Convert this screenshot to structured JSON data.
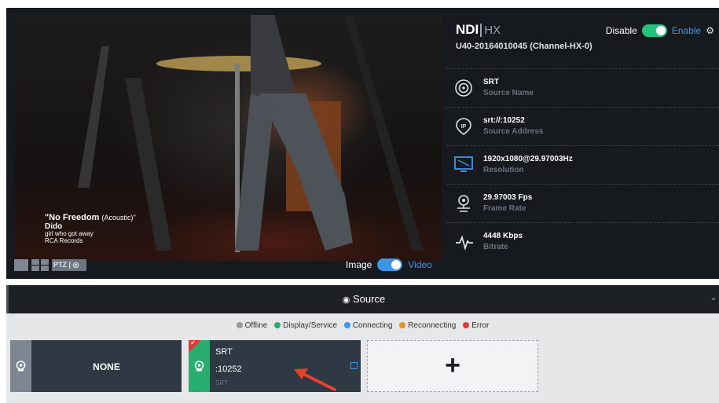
{
  "video": {
    "caption": {
      "song": "\"No Freedom",
      "song_suffix": "(Acoustic)\"",
      "artist": "Dido",
      "album": "girl who got away",
      "label": "RCA Records"
    }
  },
  "header": {
    "logo_main": "NDI",
    "logo_suffix": "HX",
    "device_name": "U40-20164010045 (Channel-HX-0)",
    "disable_label": "Disable",
    "enable_label": "Enable",
    "switch_on": true
  },
  "info_rows": [
    {
      "icon": "source-name-icon",
      "value": "SRT",
      "key": "Source Name"
    },
    {
      "icon": "ip-address-icon",
      "value": "srt://:10252",
      "key": "Source Address"
    },
    {
      "icon": "monitor-icon",
      "value": "1920x1080@29.97003Hz",
      "key": "Resolution"
    },
    {
      "icon": "frame-rate-icon",
      "value": "29.97003 Fps",
      "key": "Frame Rate"
    },
    {
      "icon": "bitrate-icon",
      "value": "4448 Kbps",
      "key": "Bitrate"
    }
  ],
  "controls": {
    "ptz_label": "PTZ",
    "image_label": "Image",
    "video_label": "Video"
  },
  "source_bar": {
    "title": "Source"
  },
  "legend": [
    {
      "label": "Offline",
      "color": "#9a9a9a"
    },
    {
      "label": "Display/Service",
      "color": "#27ae6f"
    },
    {
      "label": "Connecting",
      "color": "#3e95e6"
    },
    {
      "label": "Reconnecting",
      "color": "#e8912c"
    },
    {
      "label": "Error",
      "color": "#e03a3a"
    }
  ],
  "cards": {
    "none": {
      "name": "NONE"
    },
    "srt": {
      "name": "SRT",
      "address": ":10252",
      "type": "SRT"
    },
    "add": {
      "symbol": "+"
    }
  },
  "colors": {
    "accent_blue": "#3e95e6",
    "online_green": "#27ae6f",
    "error_red": "#e03a3a",
    "dark_panel": "#161a1f"
  }
}
